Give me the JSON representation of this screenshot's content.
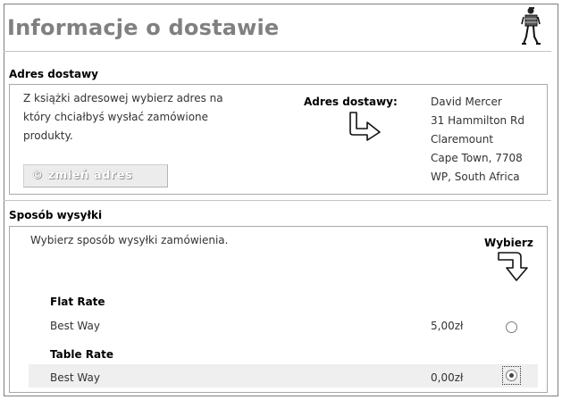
{
  "header": {
    "title": "Informacje o dostawie",
    "logo_icon": "mover-with-box-icon"
  },
  "delivery_address": {
    "heading": "Adres dostawy",
    "instructions_line1": "Z książki adresowej wybierz adres na",
    "instructions_line2": "który chciałbyś wysłać zamówione",
    "instructions_line3": "produkty.",
    "change_button": "zmień adres",
    "address_label": "Adres dostawy:",
    "arrow_icon": "curved-arrow-right-icon",
    "address_lines": [
      "David Mercer",
      "31 Hammilton Rd",
      "Claremount",
      "Cape Town, 7708",
      "WP, South Africa"
    ]
  },
  "shipping": {
    "heading": "Sposób wysyłki",
    "instructions": "Wybierz sposób wysyłki zamówienia.",
    "choose_label": "Wybierz",
    "arrow_icon": "curved-arrow-down-icon",
    "methods": [
      {
        "name": "Flat Rate",
        "option": "Best Way",
        "price": "5,00zł",
        "selected": false
      },
      {
        "name": "Table Rate",
        "option": "Best Way",
        "price": "0,00zł",
        "selected": true
      }
    ]
  }
}
